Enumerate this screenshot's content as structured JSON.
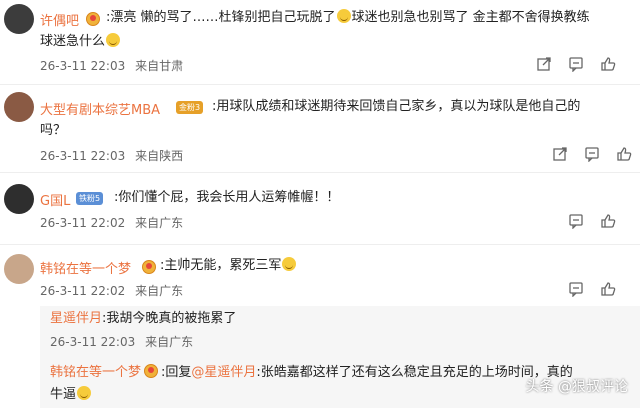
{
  "comments": [
    {
      "username": "许偶吧",
      "text_a": ":漂亮 懒的骂了……杜锋别把自己玩脱了",
      "text_b": "球迷也别急也别骂了 金主都不舍得换教练",
      "text_c": "球迷急什么",
      "time": "26-3-11 22:03",
      "location": "来自甘肃"
    },
    {
      "username": "大型有剧本综艺MBA",
      "badge": "金粉3",
      "text_a": ":用球队成绩和球迷期待来回馈自己家乡，真以为球队是他自己的",
      "text_b": "吗？",
      "time": "26-3-11 22:03",
      "location": "来自陕西"
    },
    {
      "username": "G国L",
      "badge": "铁粉5",
      "text_a": ":你们懂个屁，我会长用人运筹帷幄！！",
      "time": "26-3-11 22:02",
      "location": "来自广东"
    },
    {
      "username": "韩铭在等一个梦",
      "text_a": ":主帅无能，累死三军",
      "time": "26-3-11 22:02",
      "location": "来自广东"
    }
  ],
  "replies": [
    {
      "username": "星遥伴月",
      "text_a": ":我胡今晚真的被拖累了",
      "time": "26-3-11 22:03",
      "location": "来自广东"
    },
    {
      "username": "韩铭在等一个梦",
      "reply_prefix": ":回复",
      "mention": "@星遥伴月",
      "text_a": ":张皓嘉都这样了还有这么稳定且充足的上场时间，真的",
      "text_b": "牛逼"
    }
  ],
  "watermark": "头条 @狠叔评论",
  "colors": {
    "username": "#eb7340",
    "meta": "#666666",
    "reply_bg": "#f6f6f6"
  },
  "icons": [
    "share-icon",
    "comment-icon",
    "like-icon"
  ]
}
